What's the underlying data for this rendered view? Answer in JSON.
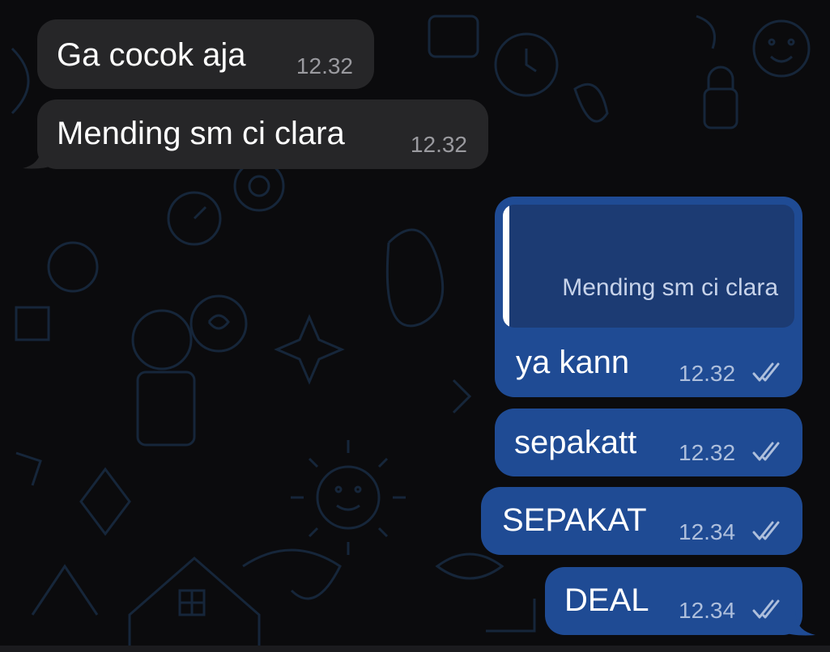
{
  "chat": {
    "messages": [
      {
        "direction": "incoming",
        "text": "Ga cocok aja",
        "time": "12.32"
      },
      {
        "direction": "incoming",
        "text": "Mending sm ci clara",
        "time": "12.32"
      },
      {
        "direction": "outgoing",
        "reply_to": "Mending sm ci clara",
        "text": "ya kann",
        "time": "12.32",
        "status_icon": "double-check-icon"
      },
      {
        "direction": "outgoing",
        "text": "sepakatt",
        "time": "12.32",
        "status_icon": "double-check-icon"
      },
      {
        "direction": "outgoing",
        "text": "SEPAKAT",
        "time": "12.34",
        "status_icon": "double-check-icon"
      },
      {
        "direction": "outgoing",
        "text": "DEAL",
        "time": "12.34",
        "status_icon": "double-check-icon"
      }
    ]
  },
  "colors": {
    "background": "#0b0b0d",
    "incoming_bubble": "#262628",
    "outgoing_bubble": "#1f4b94",
    "quote_background": "#1c3b73",
    "wallpaper_doodle": "#16263a"
  }
}
